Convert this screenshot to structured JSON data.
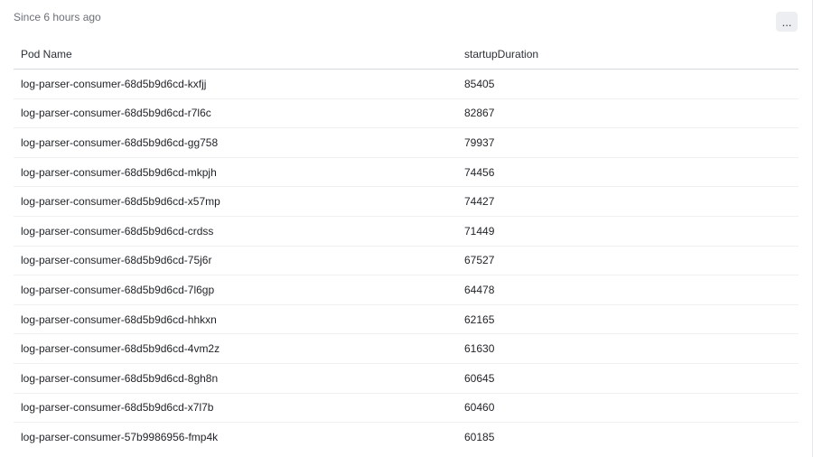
{
  "panel": {
    "time_range": "Since 6 hours ago",
    "more_label": "..."
  },
  "table": {
    "columns": [
      "Pod Name",
      "startupDuration"
    ],
    "rows": [
      {
        "pod": "log-parser-consumer-68d5b9d6cd-kxfjj",
        "duration": "85405"
      },
      {
        "pod": "log-parser-consumer-68d5b9d6cd-r7l6c",
        "duration": "82867"
      },
      {
        "pod": "log-parser-consumer-68d5b9d6cd-gg758",
        "duration": "79937"
      },
      {
        "pod": "log-parser-consumer-68d5b9d6cd-mkpjh",
        "duration": "74456"
      },
      {
        "pod": "log-parser-consumer-68d5b9d6cd-x57mp",
        "duration": "74427"
      },
      {
        "pod": "log-parser-consumer-68d5b9d6cd-crdss",
        "duration": "71449"
      },
      {
        "pod": "log-parser-consumer-68d5b9d6cd-75j6r",
        "duration": "67527"
      },
      {
        "pod": "log-parser-consumer-68d5b9d6cd-7l6gp",
        "duration": "64478"
      },
      {
        "pod": "log-parser-consumer-68d5b9d6cd-hhkxn",
        "duration": "62165"
      },
      {
        "pod": "log-parser-consumer-68d5b9d6cd-4vm2z",
        "duration": "61630"
      },
      {
        "pod": "log-parser-consumer-68d5b9d6cd-8gh8n",
        "duration": "60645"
      },
      {
        "pod": "log-parser-consumer-68d5b9d6cd-x7l7b",
        "duration": "60460"
      },
      {
        "pod": "log-parser-consumer-57b9986956-fmp4k",
        "duration": "60185"
      }
    ]
  }
}
